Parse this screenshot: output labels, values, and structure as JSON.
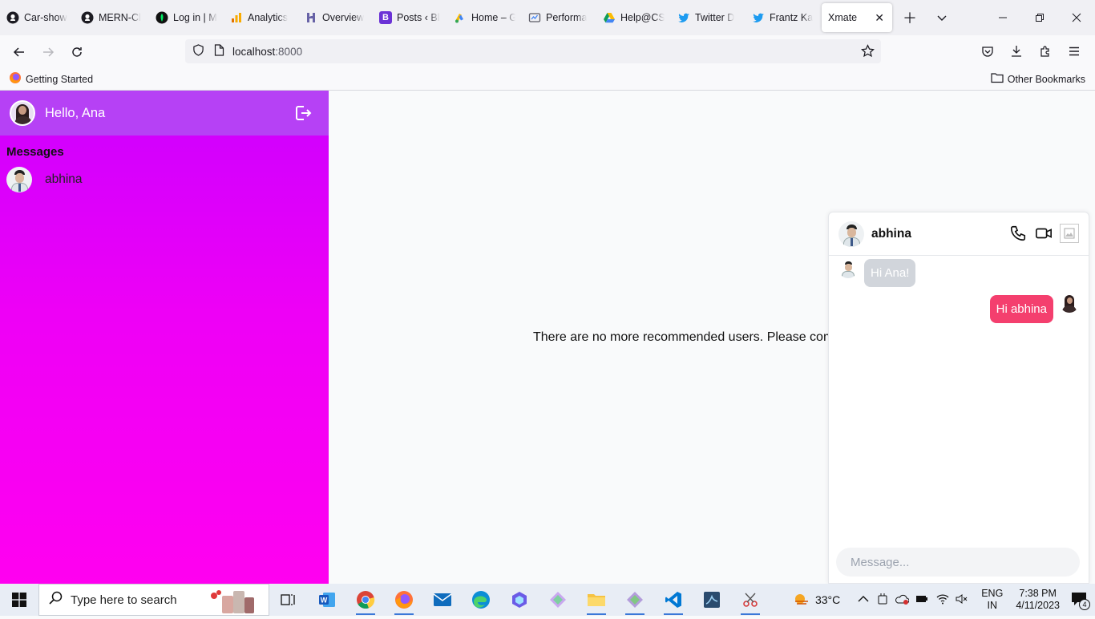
{
  "browser": {
    "tabs": [
      {
        "title": "Car-show",
        "icon": "github-icon"
      },
      {
        "title": "MERN-Cl",
        "icon": "github-icon"
      },
      {
        "title": "Log in | M",
        "icon": "leaf-icon"
      },
      {
        "title": "Analytics",
        "icon": "analytics-icon"
      },
      {
        "title": "Overview",
        "icon": "heroku-icon"
      },
      {
        "title": "Posts ‹ Bl",
        "icon": "blogger-icon"
      },
      {
        "title": "Home – G",
        "icon": "google-ads-icon"
      },
      {
        "title": "Performa",
        "icon": "performance-icon"
      },
      {
        "title": "Help@CS",
        "icon": "google-drive-icon"
      },
      {
        "title": "Twitter D",
        "icon": "twitter-icon"
      },
      {
        "title": "Frantz Ka",
        "icon": "twitter-icon"
      },
      {
        "title": "Xmate",
        "icon": "none",
        "active": true
      }
    ],
    "url_host": "localhost",
    "url_port": ":8000",
    "bookmark": "Getting Started",
    "other_bookmarks": "Other Bookmarks"
  },
  "sidebar": {
    "greeting": "Hello, Ana",
    "section_title": "Messages",
    "conversations": [
      {
        "name": "abhina"
      }
    ]
  },
  "main": {
    "empty_message": "There are no more recommended users. Please come"
  },
  "chat": {
    "contact_name": "abhina",
    "messages": [
      {
        "direction": "in",
        "text": "Hi Ana!"
      },
      {
        "direction": "out",
        "text": "Hi abhina"
      }
    ],
    "input_placeholder": "Message..."
  },
  "taskbar": {
    "search_placeholder": "Type here to search",
    "weather": "33°C",
    "lang": "ENG",
    "region": "IN",
    "time": "7:38 PM",
    "date": "4/11/2023",
    "notification_count": "4"
  },
  "colors": {
    "sidebar_header": "#b641f5",
    "sidebar_gradient_top": "#cc00ff",
    "sidebar_gradient_bottom": "#ff00f0",
    "outgoing_bubble": "#f43f6e",
    "incoming_bubble": "#d1d5db"
  }
}
